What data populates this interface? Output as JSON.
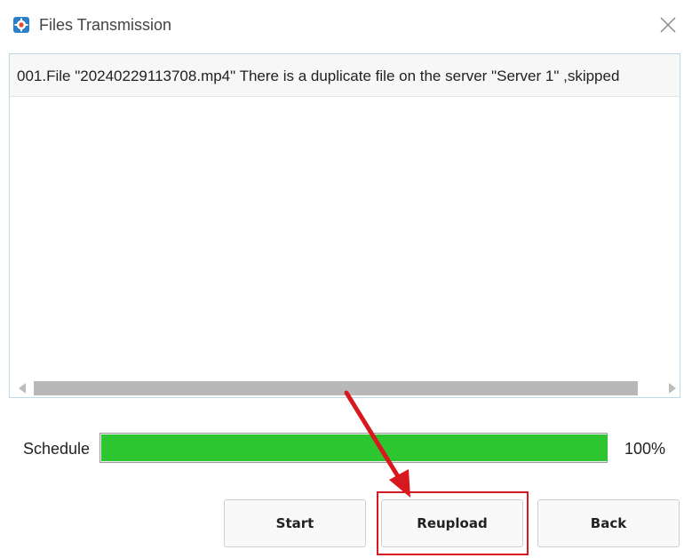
{
  "window": {
    "title": "Files Transmission",
    "icon": "settings-gear-icon",
    "close_icon": "close-icon"
  },
  "log": {
    "entries": [
      "001.File \"20240229113708.mp4\" There is a duplicate file on the server \"Server 1\" ,skipped"
    ]
  },
  "progress": {
    "label": "Schedule",
    "value": 1.0,
    "percent_text": "100%",
    "fill_color": "#2ec630"
  },
  "buttons": {
    "start": "Start",
    "reupload": "Reupload",
    "back": "Back"
  },
  "annotation": {
    "highlight_color": "#d7191f"
  }
}
